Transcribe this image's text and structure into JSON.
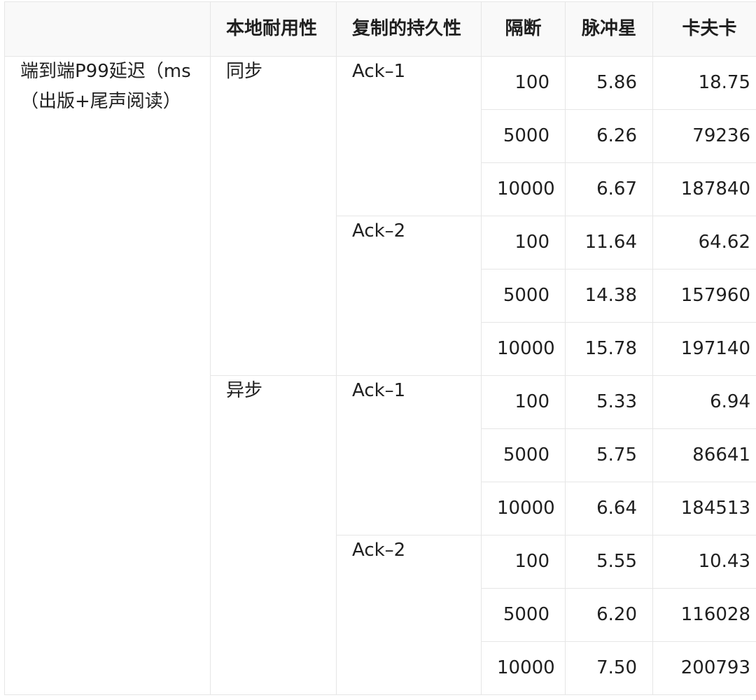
{
  "table": {
    "headers": [
      "",
      "本地耐用性",
      "复制的持久性",
      "隔断",
      "脉冲星",
      "卡夫卡"
    ],
    "metric": "端到端P99延迟（ms（出版+尾声阅读）",
    "groups": [
      {
        "sync": "同步",
        "acks": [
          {
            "ack": "Ack–1",
            "rows": [
              {
                "partitions": "100",
                "pulsar": "5.86",
                "kafka": "18.75"
              },
              {
                "partitions": "5000",
                "pulsar": "6.26",
                "kafka": "79236"
              },
              {
                "partitions": "10000",
                "pulsar": "6.67",
                "kafka": "187840"
              }
            ]
          },
          {
            "ack": "Ack–2",
            "rows": [
              {
                "partitions": "100",
                "pulsar": "11.64",
                "kafka": "64.62"
              },
              {
                "partitions": "5000",
                "pulsar": "14.38",
                "kafka": "157960"
              },
              {
                "partitions": "10000",
                "pulsar": "15.78",
                "kafka": "197140"
              }
            ]
          }
        ]
      },
      {
        "sync": "异步",
        "acks": [
          {
            "ack": "Ack–1",
            "rows": [
              {
                "partitions": "100",
                "pulsar": "5.33",
                "kafka": "6.94"
              },
              {
                "partitions": "5000",
                "pulsar": "5.75",
                "kafka": "86641"
              },
              {
                "partitions": "10000",
                "pulsar": "6.64",
                "kafka": "184513"
              }
            ]
          },
          {
            "ack": "Ack–2",
            "rows": [
              {
                "partitions": "100",
                "pulsar": "5.55",
                "kafka": "10.43"
              },
              {
                "partitions": "5000",
                "pulsar": "6.20",
                "kafka": "116028"
              },
              {
                "partitions": "10000",
                "pulsar": "7.50",
                "kafka": "200793"
              }
            ]
          }
        ]
      }
    ]
  },
  "colors": {
    "border": "#e6e6e6",
    "header_background": "#f9f9f9",
    "text": "#1f1f1f"
  }
}
